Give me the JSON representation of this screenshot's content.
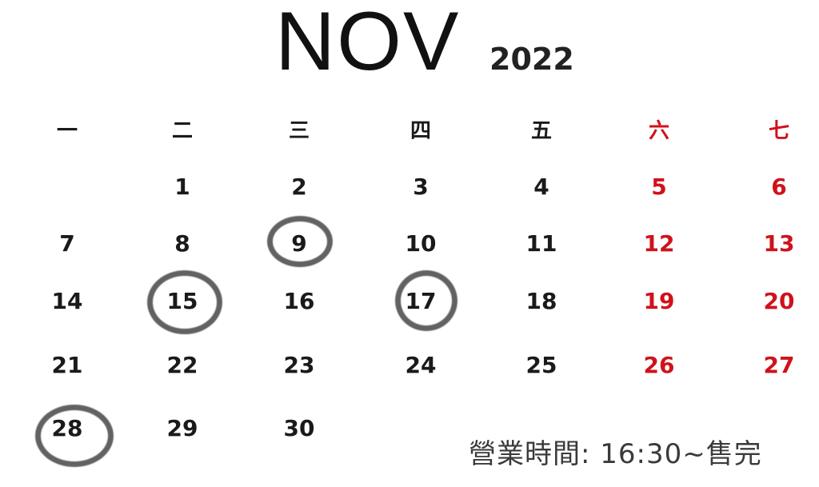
{
  "header": {
    "month": "NOV",
    "year": "2022"
  },
  "weekdays": [
    "一",
    "二",
    "三",
    "四",
    "五",
    "六",
    "七"
  ],
  "weeks": [
    [
      "",
      "1",
      "2",
      "3",
      "4",
      "5",
      "6"
    ],
    [
      "7",
      "8",
      "9",
      "10",
      "11",
      "12",
      "13"
    ],
    [
      "14",
      "15",
      "16",
      "17",
      "18",
      "19",
      "20"
    ],
    [
      "21",
      "22",
      "23",
      "24",
      "25",
      "26",
      "27"
    ],
    [
      "28",
      "29",
      "30",
      "",
      "",
      "",
      ""
    ]
  ],
  "circled_days": [
    "9",
    "15",
    "17",
    "28"
  ],
  "footer": {
    "hours": "營業時間: 16:30~售完"
  },
  "colors": {
    "text": "#1a1a1a",
    "weekend": "#d0121b",
    "circle": "#555555"
  }
}
